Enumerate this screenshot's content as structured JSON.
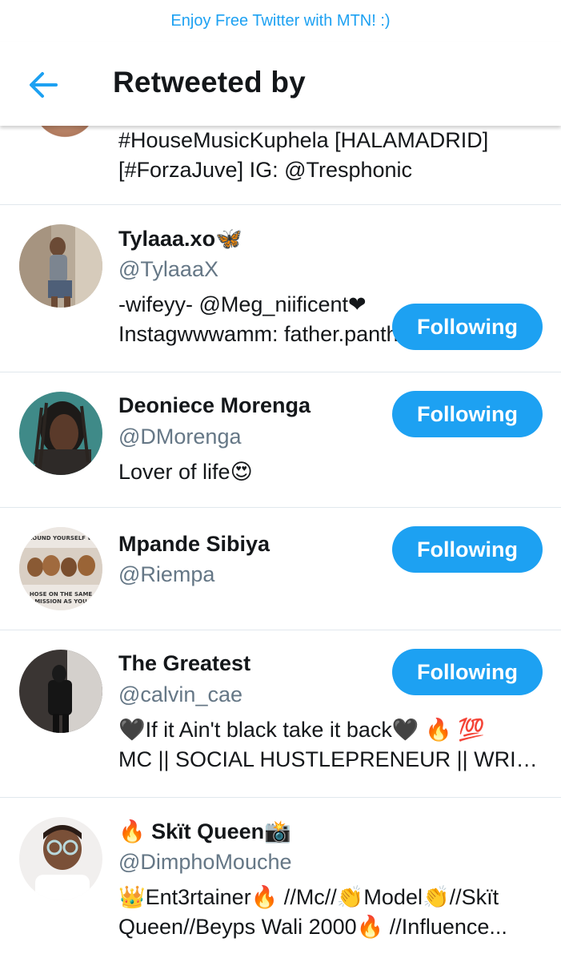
{
  "promo_text": "Enjoy Free Twitter with MTN! :)",
  "header": {
    "title": "Retweeted by",
    "back_icon": "arrow-left-icon"
  },
  "accent_color": "#1da1f2",
  "users": [
    {
      "name": "",
      "handle": "",
      "bio": [
        "#HouseMusicKuphela [HALAMADRID]",
        "[#ForzaJuve]   IG: @Tresphonic"
      ],
      "button": ""
    },
    {
      "name": "Tylaaa.xo🦋",
      "handle": "@TylaaaX",
      "bio": [
        "-wifeyy- @Meg_niificent❤",
        "Instagwwwamm: father.panther"
      ],
      "button": "Following"
    },
    {
      "name": "Deoniece Morenga",
      "handle": "@DMorenga",
      "bio": [
        "Lover of life😍"
      ],
      "button": "Following"
    },
    {
      "name": "Mpande Sibiya",
      "handle": "@Riempa",
      "bio": [],
      "button": "Following",
      "avatar_text": [
        "ROUND YOURSELF W",
        "HOSE ON THE SAME",
        "MISSION AS YOU"
      ]
    },
    {
      "name": "The Greatest",
      "handle": "@calvin_cae",
      "bio": [
        "🖤If it Ain't black take it back🖤 🔥 💯",
        "MC || SOCIAL HUSTLEPRENEUR || WRIT..."
      ],
      "button": "Following"
    },
    {
      "name": "🔥 Skït Queen📸",
      "handle": "@DimphoMouche",
      "bio": [
        "👑Ent3rtainer🔥 //Mc//👏Model👏//Skït",
        "Queen//Beyps Wali 2000🔥 //Influence..."
      ],
      "button": ""
    }
  ]
}
